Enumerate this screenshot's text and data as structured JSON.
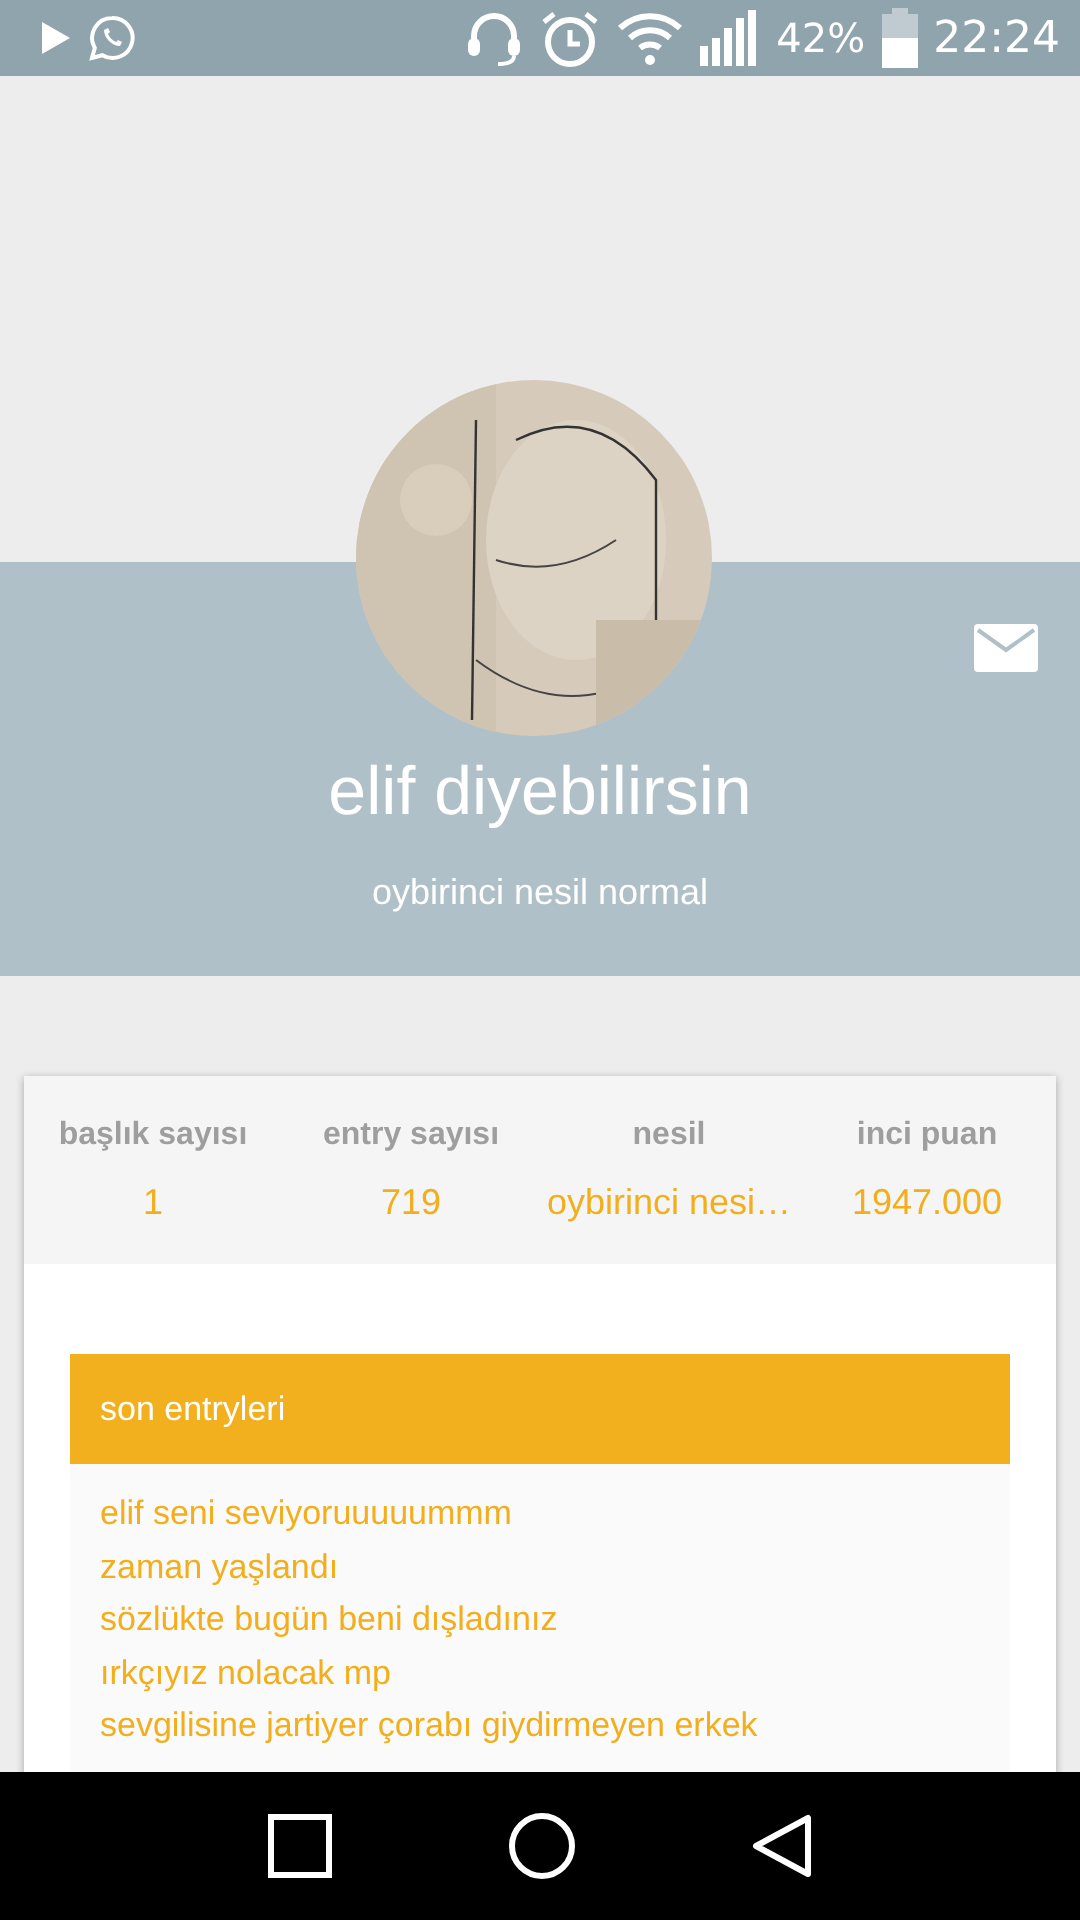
{
  "status_bar": {
    "battery": "42%",
    "time": "22:24"
  },
  "profile": {
    "name": "elif diyebilirsin",
    "subtitle": "oybirinci nesil normal"
  },
  "stats": [
    {
      "label": "başlık sayısı",
      "value": "1"
    },
    {
      "label": "entry sayısı",
      "value": "719"
    },
    {
      "label": "nesil",
      "value": "oybirinci nesi…"
    },
    {
      "label": "inci puan",
      "value": "1947.000"
    }
  ],
  "recent": {
    "title": "son entryleri",
    "items": [
      "elif seni seviyoruuuuummm",
      "zaman yaşlandı",
      "sözlükte bugün beni dışladınız",
      "ırkçıyız nolacak mp",
      "sevgilisine jartiyer çorabı giydirmeyen erkek"
    ]
  }
}
